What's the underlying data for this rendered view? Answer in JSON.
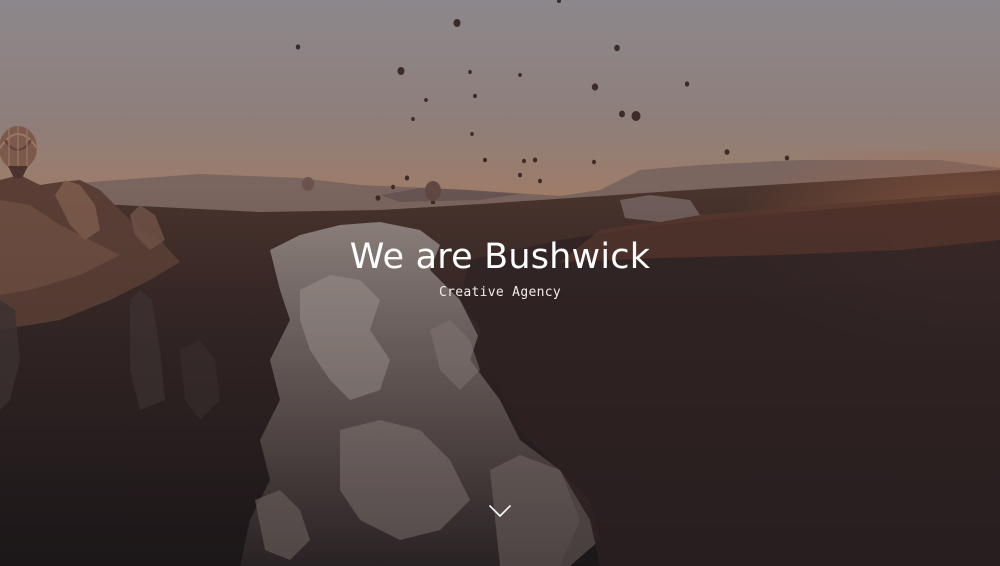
{
  "hero": {
    "title": "We are Bushwick",
    "subtitle": "Creative Agency"
  },
  "icons": {
    "scroll": "chevron-down-icon"
  },
  "colors": {
    "text": "#ffffff",
    "sky_top": "#9c979c",
    "sky_horizon": "#c29a82",
    "ground_dark": "#2b2427"
  }
}
